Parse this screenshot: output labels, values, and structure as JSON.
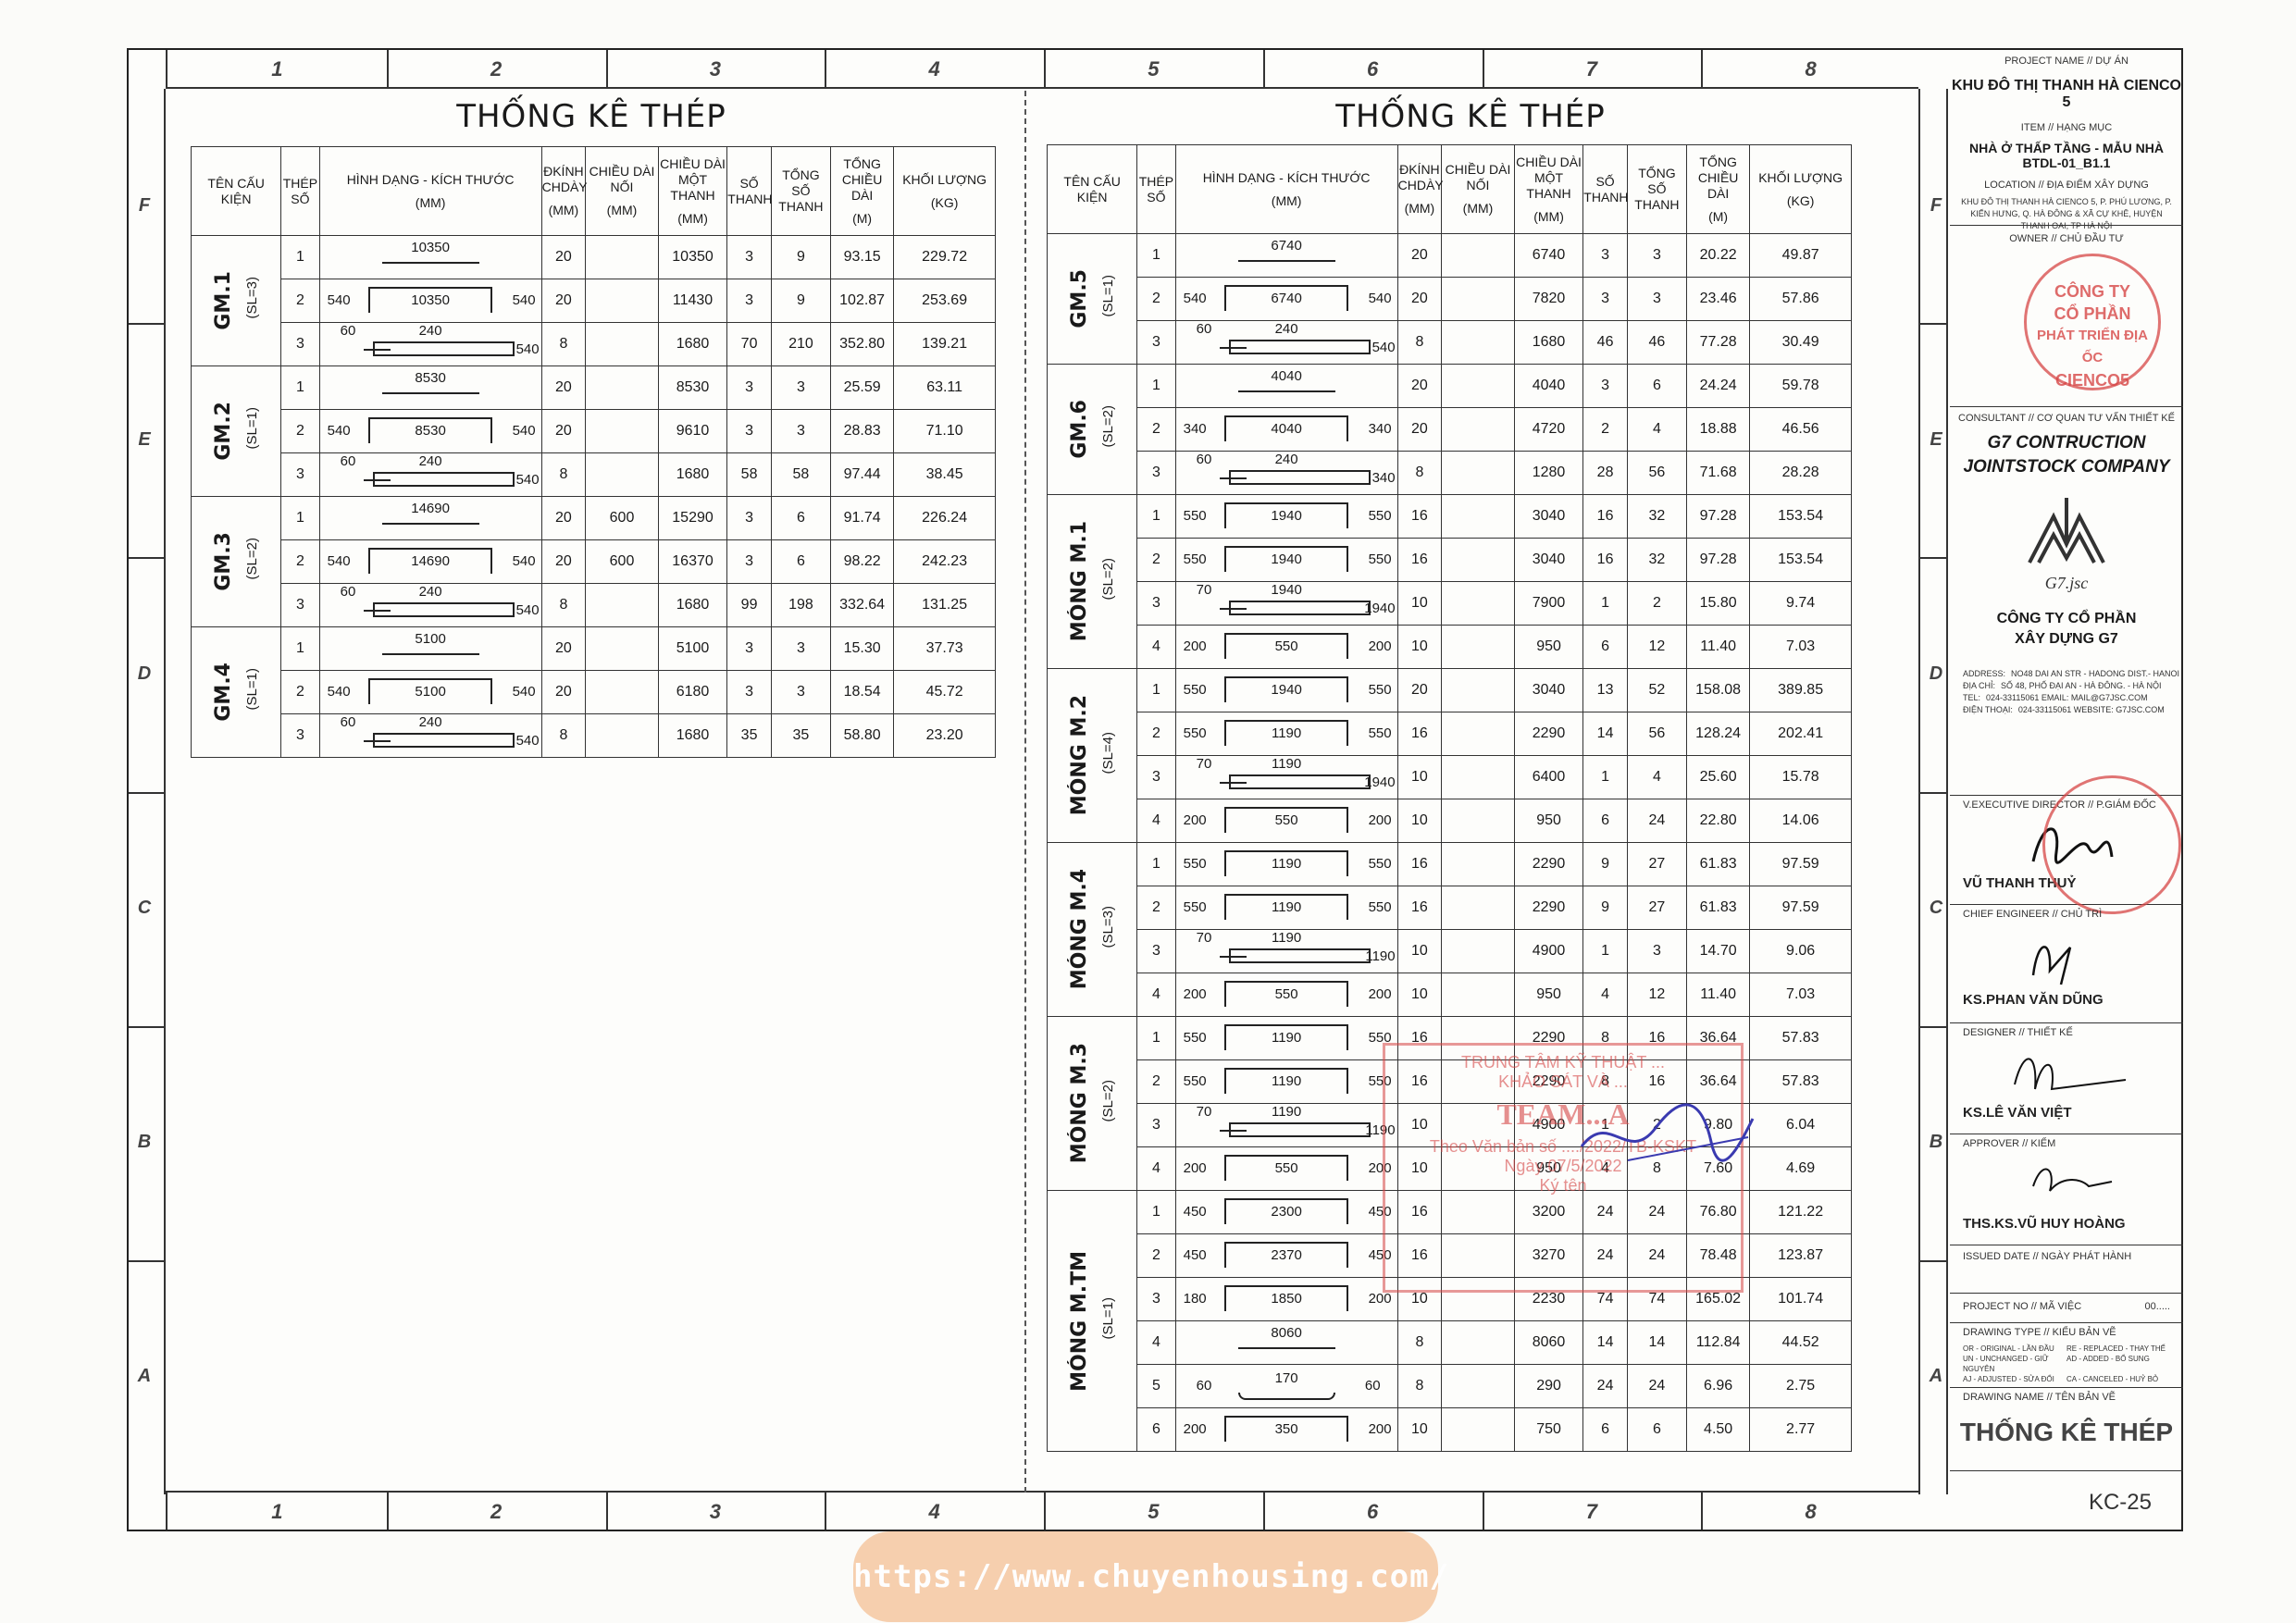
{
  "zones": {
    "columns": [
      "1",
      "2",
      "3",
      "4",
      "5",
      "6",
      "7",
      "8"
    ],
    "rows": [
      "F",
      "E",
      "D",
      "C",
      "B",
      "A"
    ]
  },
  "left_title": "THỐNG KÊ THÉP",
  "right_title": "THỐNG KÊ THÉP",
  "headers": {
    "ten_cau_kien": "TÊN CẤU KIỆN",
    "thep_so": "THÉP SỐ",
    "hinh_dang": "HÌNH DẠNG - KÍCH THƯỚC",
    "hinh_dang_unit": "(MM)",
    "dkinh": "ĐKÍNH CHDÀY",
    "dkinh_unit": "(MM)",
    "chieu_dai_noi": "CHIỀU DÀI NỐI",
    "chieu_dai_noi_unit": "(MM)",
    "chieu_dai_mot": "CHIỀU DÀI MỘT THANH",
    "chieu_dai_mot_unit": "(MM)",
    "so_thanh": "SỐ THANH",
    "tong_so": "TỔNG SỐ THANH",
    "tong_chieu_dai": "TỔNG CHIỀU DÀI",
    "tong_chieu_dai_unit": "(M)",
    "khoi_luong": "KHỐI LƯỢNG",
    "khoi_luong_unit": "(KG)"
  },
  "left_groups": [
    {
      "name": "GM.1",
      "sl": "(SL=3)",
      "rows": [
        {
          "no": "1",
          "shape": {
            "type": "straight",
            "main": "10350"
          },
          "dk": "20",
          "noi": "",
          "mot": "10350",
          "so": "3",
          "tong": "9",
          "tcd": "93.15",
          "kl": "229.72"
        },
        {
          "no": "2",
          "shape": {
            "type": "u",
            "main": "10350",
            "l": "540",
            "r": "540"
          },
          "dk": "20",
          "noi": "",
          "mot": "11430",
          "so": "3",
          "tong": "9",
          "tcd": "102.87",
          "kl": "253.69"
        },
        {
          "no": "3",
          "shape": {
            "type": "stirrup",
            "main": "240",
            "l": "60",
            "r": "540"
          },
          "dk": "8",
          "noi": "",
          "mot": "1680",
          "so": "70",
          "tong": "210",
          "tcd": "352.80",
          "kl": "139.21"
        }
      ]
    },
    {
      "name": "GM.2",
      "sl": "(SL=1)",
      "rows": [
        {
          "no": "1",
          "shape": {
            "type": "straight",
            "main": "8530"
          },
          "dk": "20",
          "noi": "",
          "mot": "8530",
          "so": "3",
          "tong": "3",
          "tcd": "25.59",
          "kl": "63.11"
        },
        {
          "no": "2",
          "shape": {
            "type": "u",
            "main": "8530",
            "l": "540",
            "r": "540"
          },
          "dk": "20",
          "noi": "",
          "mot": "9610",
          "so": "3",
          "tong": "3",
          "tcd": "28.83",
          "kl": "71.10"
        },
        {
          "no": "3",
          "shape": {
            "type": "stirrup",
            "main": "240",
            "l": "60",
            "r": "540"
          },
          "dk": "8",
          "noi": "",
          "mot": "1680",
          "so": "58",
          "tong": "58",
          "tcd": "97.44",
          "kl": "38.45"
        }
      ]
    },
    {
      "name": "GM.3",
      "sl": "(SL=2)",
      "rows": [
        {
          "no": "1",
          "shape": {
            "type": "straight",
            "main": "14690"
          },
          "dk": "20",
          "noi": "600",
          "mot": "15290",
          "so": "3",
          "tong": "6",
          "tcd": "91.74",
          "kl": "226.24"
        },
        {
          "no": "2",
          "shape": {
            "type": "u",
            "main": "14690",
            "l": "540",
            "r": "540"
          },
          "dk": "20",
          "noi": "600",
          "mot": "16370",
          "so": "3",
          "tong": "6",
          "tcd": "98.22",
          "kl": "242.23"
        },
        {
          "no": "3",
          "shape": {
            "type": "stirrup",
            "main": "240",
            "l": "60",
            "r": "540"
          },
          "dk": "8",
          "noi": "",
          "mot": "1680",
          "so": "99",
          "tong": "198",
          "tcd": "332.64",
          "kl": "131.25"
        }
      ]
    },
    {
      "name": "GM.4",
      "sl": "(SL=1)",
      "rows": [
        {
          "no": "1",
          "shape": {
            "type": "straight",
            "main": "5100"
          },
          "dk": "20",
          "noi": "",
          "mot": "5100",
          "so": "3",
          "tong": "3",
          "tcd": "15.30",
          "kl": "37.73"
        },
        {
          "no": "2",
          "shape": {
            "type": "u",
            "main": "5100",
            "l": "540",
            "r": "540"
          },
          "dk": "20",
          "noi": "",
          "mot": "6180",
          "so": "3",
          "tong": "3",
          "tcd": "18.54",
          "kl": "45.72"
        },
        {
          "no": "3",
          "shape": {
            "type": "stirrup",
            "main": "240",
            "l": "60",
            "r": "540"
          },
          "dk": "8",
          "noi": "",
          "mot": "1680",
          "so": "35",
          "tong": "35",
          "tcd": "58.80",
          "kl": "23.20"
        }
      ]
    }
  ],
  "right_groups": [
    {
      "name": "GM.5",
      "sl": "(SL=1)",
      "rows": [
        {
          "no": "1",
          "shape": {
            "type": "straight",
            "main": "6740"
          },
          "dk": "20",
          "noi": "",
          "mot": "6740",
          "so": "3",
          "tong": "3",
          "tcd": "20.22",
          "kl": "49.87"
        },
        {
          "no": "2",
          "shape": {
            "type": "u",
            "main": "6740",
            "l": "540",
            "r": "540"
          },
          "dk": "20",
          "noi": "",
          "mot": "7820",
          "so": "3",
          "tong": "3",
          "tcd": "23.46",
          "kl": "57.86"
        },
        {
          "no": "3",
          "shape": {
            "type": "stirrup",
            "main": "240",
            "l": "60",
            "r": "540"
          },
          "dk": "8",
          "noi": "",
          "mot": "1680",
          "so": "46",
          "tong": "46",
          "tcd": "77.28",
          "kl": "30.49"
        }
      ]
    },
    {
      "name": "GM.6",
      "sl": "(SL=2)",
      "rows": [
        {
          "no": "1",
          "shape": {
            "type": "straight",
            "main": "4040"
          },
          "dk": "20",
          "noi": "",
          "mot": "4040",
          "so": "3",
          "tong": "6",
          "tcd": "24.24",
          "kl": "59.78"
        },
        {
          "no": "2",
          "shape": {
            "type": "u",
            "main": "4040",
            "l": "340",
            "r": "340"
          },
          "dk": "20",
          "noi": "",
          "mot": "4720",
          "so": "2",
          "tong": "4",
          "tcd": "18.88",
          "kl": "46.56"
        },
        {
          "no": "3",
          "shape": {
            "type": "stirrup",
            "main": "240",
            "l": "60",
            "r": "340"
          },
          "dk": "8",
          "noi": "",
          "mot": "1280",
          "so": "28",
          "tong": "56",
          "tcd": "71.68",
          "kl": "28.28"
        }
      ]
    },
    {
      "name": "MÓNG M.1",
      "sl": "(SL=2)",
      "rows": [
        {
          "no": "1",
          "shape": {
            "type": "u",
            "main": "1940",
            "l": "550",
            "r": "550"
          },
          "dk": "16",
          "noi": "",
          "mot": "3040",
          "so": "16",
          "tong": "32",
          "tcd": "97.28",
          "kl": "153.54"
        },
        {
          "no": "2",
          "shape": {
            "type": "u",
            "main": "1940",
            "l": "550",
            "r": "550"
          },
          "dk": "16",
          "noi": "",
          "mot": "3040",
          "so": "16",
          "tong": "32",
          "tcd": "97.28",
          "kl": "153.54"
        },
        {
          "no": "3",
          "shape": {
            "type": "stirrup",
            "main": "1940",
            "l": "70",
            "r": "1940"
          },
          "dk": "10",
          "noi": "",
          "mot": "7900",
          "so": "1",
          "tong": "2",
          "tcd": "15.80",
          "kl": "9.74"
        },
        {
          "no": "4",
          "shape": {
            "type": "u",
            "main": "550",
            "l": "200",
            "r": "200"
          },
          "dk": "10",
          "noi": "",
          "mot": "950",
          "so": "6",
          "tong": "12",
          "tcd": "11.40",
          "kl": "7.03"
        }
      ]
    },
    {
      "name": "MÓNG M.2",
      "sl": "(SL=4)",
      "rows": [
        {
          "no": "1",
          "shape": {
            "type": "u",
            "main": "1940",
            "l": "550",
            "r": "550"
          },
          "dk": "20",
          "noi": "",
          "mot": "3040",
          "so": "13",
          "tong": "52",
          "tcd": "158.08",
          "kl": "389.85"
        },
        {
          "no": "2",
          "shape": {
            "type": "u",
            "main": "1190",
            "l": "550",
            "r": "550"
          },
          "dk": "16",
          "noi": "",
          "mot": "2290",
          "so": "14",
          "tong": "56",
          "tcd": "128.24",
          "kl": "202.41"
        },
        {
          "no": "3",
          "shape": {
            "type": "stirrup",
            "main": "1190",
            "l": "70",
            "r": "1940"
          },
          "dk": "10",
          "noi": "",
          "mot": "6400",
          "so": "1",
          "tong": "4",
          "tcd": "25.60",
          "kl": "15.78"
        },
        {
          "no": "4",
          "shape": {
            "type": "u",
            "main": "550",
            "l": "200",
            "r": "200"
          },
          "dk": "10",
          "noi": "",
          "mot": "950",
          "so": "6",
          "tong": "24",
          "tcd": "22.80",
          "kl": "14.06"
        }
      ]
    },
    {
      "name": "MÓNG M.4",
      "sl": "(SL=3)",
      "rows": [
        {
          "no": "1",
          "shape": {
            "type": "u",
            "main": "1190",
            "l": "550",
            "r": "550"
          },
          "dk": "16",
          "noi": "",
          "mot": "2290",
          "so": "9",
          "tong": "27",
          "tcd": "61.83",
          "kl": "97.59"
        },
        {
          "no": "2",
          "shape": {
            "type": "u",
            "main": "1190",
            "l": "550",
            "r": "550"
          },
          "dk": "16",
          "noi": "",
          "mot": "2290",
          "so": "9",
          "tong": "27",
          "tcd": "61.83",
          "kl": "97.59"
        },
        {
          "no": "3",
          "shape": {
            "type": "stirrup",
            "main": "1190",
            "l": "70",
            "r": "1190"
          },
          "dk": "10",
          "noi": "",
          "mot": "4900",
          "so": "1",
          "tong": "3",
          "tcd": "14.70",
          "kl": "9.06"
        },
        {
          "no": "4",
          "shape": {
            "type": "u",
            "main": "550",
            "l": "200",
            "r": "200"
          },
          "dk": "10",
          "noi": "",
          "mot": "950",
          "so": "4",
          "tong": "12",
          "tcd": "11.40",
          "kl": "7.03"
        }
      ]
    },
    {
      "name": "MÓNG M.3",
      "sl": "(SL=2)",
      "rows": [
        {
          "no": "1",
          "shape": {
            "type": "u",
            "main": "1190",
            "l": "550",
            "r": "550"
          },
          "dk": "16",
          "noi": "",
          "mot": "2290",
          "so": "8",
          "tong": "16",
          "tcd": "36.64",
          "kl": "57.83"
        },
        {
          "no": "2",
          "shape": {
            "type": "u",
            "main": "1190",
            "l": "550",
            "r": "550"
          },
          "dk": "16",
          "noi": "",
          "mot": "2290",
          "so": "8",
          "tong": "16",
          "tcd": "36.64",
          "kl": "57.83"
        },
        {
          "no": "3",
          "shape": {
            "type": "stirrup",
            "main": "1190",
            "l": "70",
            "r": "1190"
          },
          "dk": "10",
          "noi": "",
          "mot": "4900",
          "so": "1",
          "tong": "2",
          "tcd": "9.80",
          "kl": "6.04"
        },
        {
          "no": "4",
          "shape": {
            "type": "u",
            "main": "550",
            "l": "200",
            "r": "200"
          },
          "dk": "10",
          "noi": "",
          "mot": "950",
          "so": "4",
          "tong": "8",
          "tcd": "7.60",
          "kl": "4.69"
        }
      ]
    },
    {
      "name": "MÓNG M.TM",
      "sl": "(SL=1)",
      "rows": [
        {
          "no": "1",
          "shape": {
            "type": "u",
            "main": "2300",
            "l": "450",
            "r": "450"
          },
          "dk": "16",
          "noi": "",
          "mot": "3200",
          "so": "24",
          "tong": "24",
          "tcd": "76.80",
          "kl": "121.22"
        },
        {
          "no": "2",
          "shape": {
            "type": "u",
            "main": "2370",
            "l": "450",
            "r": "450"
          },
          "dk": "16",
          "noi": "",
          "mot": "3270",
          "so": "24",
          "tong": "24",
          "tcd": "78.48",
          "kl": "123.87"
        },
        {
          "no": "3",
          "shape": {
            "type": "u",
            "main": "1850",
            "l": "180",
            "r": "200"
          },
          "dk": "10",
          "noi": "",
          "mot": "2230",
          "so": "74",
          "tong": "74",
          "tcd": "165.02",
          "kl": "101.74"
        },
        {
          "no": "4",
          "shape": {
            "type": "straight",
            "main": "8060"
          },
          "dk": "8",
          "noi": "",
          "mot": "8060",
          "so": "14",
          "tong": "14",
          "tcd": "112.84",
          "kl": "44.52"
        },
        {
          "no": "5",
          "shape": {
            "type": "hook",
            "main": "170",
            "l": "60",
            "r": "60"
          },
          "dk": "8",
          "noi": "",
          "mot": "290",
          "so": "24",
          "tong": "24",
          "tcd": "6.96",
          "kl": "2.75"
        },
        {
          "no": "6",
          "shape": {
            "type": "u",
            "main": "350",
            "l": "200",
            "r": "200"
          },
          "dk": "10",
          "noi": "",
          "mot": "750",
          "so": "6",
          "tong": "6",
          "tcd": "4.50",
          "kl": "2.77"
        }
      ]
    }
  ],
  "titleblock": {
    "project_label": "PROJECT NAME // DỰ ÁN",
    "project_name": "KHU ĐÔ THỊ THANH HÀ CIENCO 5",
    "item_label": "ITEM // HẠNG MỤC",
    "item_name": "NHÀ Ở THẤP TẦNG - MẪU NHÀ BTDL-01_B1.1",
    "location_label": "LOCATION // ĐỊA ĐIỂM XÂY DỰNG",
    "location_text": "KHU ĐÔ THỊ THANH HÀ CIENCO 5, P. PHÚ LƯƠNG, P. KIẾN HƯNG, Q. HÀ ĐÔNG & XÃ CỰ KHÊ, HUYỆN THANH OAI, TP HÀ NỘI",
    "owner_label": "OWNER // CHỦ ĐẦU TƯ",
    "owner_stamp": {
      "line1": "CÔNG TY",
      "line2": "CỔ PHẦN",
      "line3": "PHÁT TRIỂN ĐỊA ỐC",
      "line4": "CIENCO5"
    },
    "consultant_label": "CONSULTANT // CƠ QUAN TƯ VẤN THIẾT KẾ",
    "consultant_name_1": "G7 CONTRUCTION",
    "consultant_name_2": "JOINTSTOCK COMPANY",
    "logo_text": "G7.jsc",
    "company_vn_1": "CÔNG TY CỔ PHẦN",
    "company_vn_2": "XÂY DỰNG G7",
    "address_rows": [
      {
        "k": "ADDRESS:",
        "v": "NO48 DAI AN STR - HADONG DIST.- HANOI"
      },
      {
        "k": "ĐỊA CHỈ:",
        "v": "SỐ 48, PHỐ ĐẠI AN - HÀ ĐÔNG. - HÀ NỘI"
      },
      {
        "k": "TEL:",
        "v": "024-33115061   EMAIL: MAIL@G7JSC.COM"
      },
      {
        "k": "ĐIỆN THOẠI:",
        "v": "024-33115061   WEBSITE: G7JSC.COM"
      }
    ],
    "director_label": "V.EXECUTIVE DIRECTOR // P.GIÁM ĐỐC",
    "director_name": "VŨ THANH THUỶ",
    "chief_label": "CHIEF ENGINEER // CHỦ TRÌ",
    "chief_name": "KS.PHAN VĂN DŨNG",
    "designer_label": "DESIGNER // THIẾT KẾ",
    "designer_name": "KS.LÊ VĂN VIỆT",
    "approver_label": "APPROVER // KIỂM",
    "approver_name": "THS.KS.VŨ HUY HOÀNG",
    "issued_label": "ISSUED DATE // NGÀY PHÁT HÀNH",
    "project_no_label": "PROJECT NO // MÃ VIỆC",
    "project_no_value": "00.....",
    "drawing_type_label": "DRAWING TYPE // KIỂU BẢN VẼ",
    "drawing_types": [
      "OR - ORIGINAL - LẦN ĐẦU",
      "RE - REPLACED - THAY THẾ",
      "UN - UNCHANGED - GIỮ NGUYÊN",
      "AD - ADDED - BỔ SUNG",
      "AJ - ADJUSTED - SỬA ĐỔI",
      "CA - CANCELED - HUỶ BỎ"
    ],
    "drawing_name_label": "DRAWING NAME // TÊN BẢN VẼ",
    "drawing_name": "THỐNG KÊ THÉP",
    "sheet_no": "KC-25"
  },
  "review_stamp": {
    "line1": "TRUNG TÂM KỸ THUẬT ...",
    "line2": "KHẢO SÁT VÀ ...",
    "line3": "TEAM...A",
    "line4": "Theo Văn bản số ..../2022/TB-KSKT",
    "line5": "Ngày  07/5/2022",
    "line6": "Ký tên"
  },
  "footer_url": "https://www.chuyenhousing.com/",
  "colors": {
    "stamp_red": "#d64646",
    "ink": "#1a1a1a",
    "line": "#333333",
    "footer_bg": "#f6c8a2",
    "signature_blue": "#3a3ab0"
  }
}
